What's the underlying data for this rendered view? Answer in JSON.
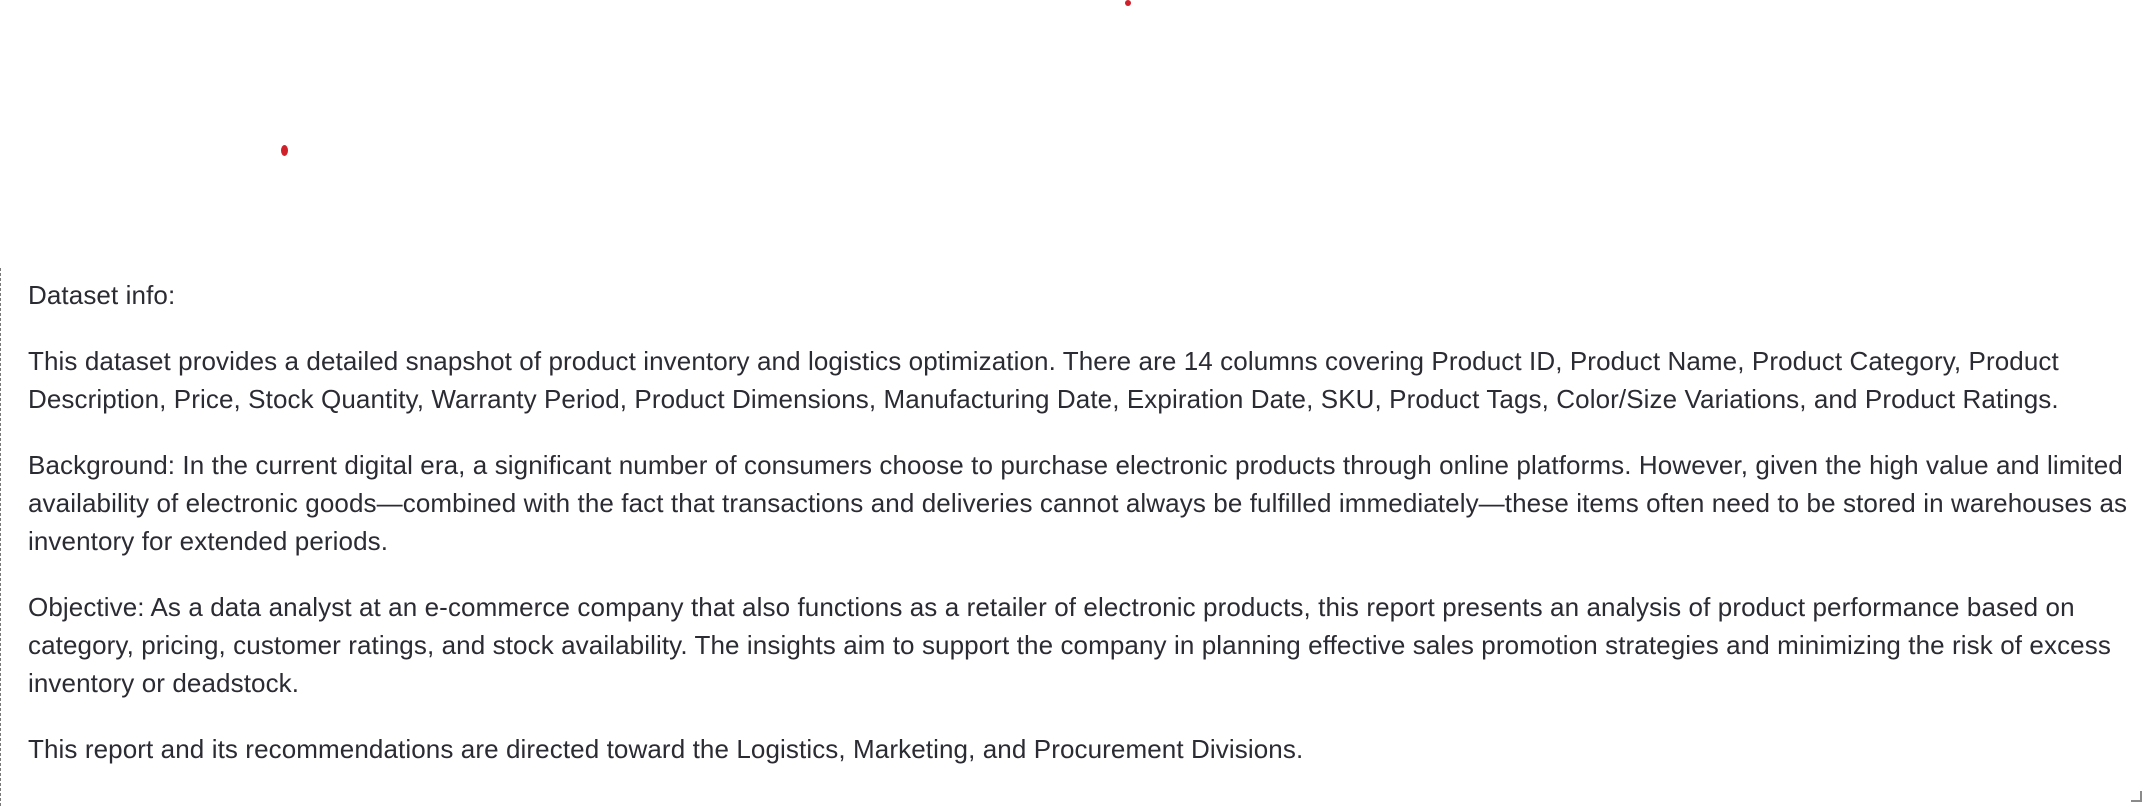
{
  "document": {
    "heading": "Dataset info:",
    "paragraphs": [
      "This dataset provides a detailed snapshot of product inventory and logistics optimization. There are 14 columns covering Product ID, Product Name, Product Category, Product Description, Price, Stock Quantity, Warranty Period, Product Dimensions, Manufacturing Date, Expiration Date, SKU, Product Tags, Color/Size Variations, and Product Ratings.",
      "Background: In the current digital era, a significant number of consumers choose to purchase electronic products through online platforms. However, given the high value and limited availability of electronic goods—combined with the fact that transactions and deliveries cannot always be fulfilled immediately—these items often need to be stored in warehouses as inventory for extended periods.",
      "Objective: As a data analyst at an e-commerce company that also functions as a retailer of electronic products, this report presents an analysis of product performance based on category, pricing, customer ratings, and stock availability. The insights aim to support the company in planning effective sales promotion strategies and minimizing the risk of excess inventory or deadstock.",
      "This report and its recommendations are directed toward the Logistics, Marketing, and Procurement Divisions."
    ]
  },
  "colors": {
    "text": "#2b2b33",
    "marker": "#d0202a",
    "background": "#ffffff"
  }
}
